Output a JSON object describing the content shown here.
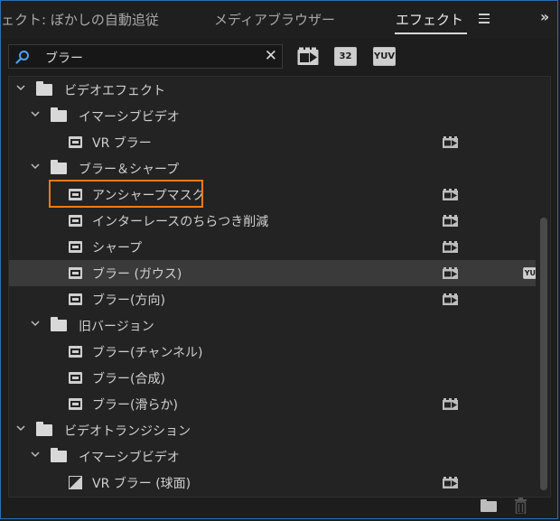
{
  "tabs": [
    {
      "label": "ェクト: ぼかしの自動追従",
      "active": false
    },
    {
      "label": "メディアブラウザー",
      "active": false
    },
    {
      "label": "エフェクト",
      "active": true
    }
  ],
  "search": {
    "value": "ブラー"
  },
  "filter_buttons": {
    "accelerated": "",
    "bit32": "32",
    "yuv": "YUV"
  },
  "tree": [
    {
      "label": "ビデオエフェクト",
      "kind": "folder",
      "level": 0
    },
    {
      "label": "イマーシブビデオ",
      "kind": "folder",
      "level": 1
    },
    {
      "label": "VR ブラー",
      "kind": "effect",
      "level": 2,
      "accel": true
    },
    {
      "label": "ブラー＆シャープ",
      "kind": "folder",
      "level": 1
    },
    {
      "label": "アンシャープマスク",
      "kind": "effect",
      "level": 2,
      "accel": true
    },
    {
      "label": "インターレースのちらつき削減",
      "kind": "effect",
      "level": 2,
      "accel": true
    },
    {
      "label": "シャープ",
      "kind": "effect",
      "level": 2,
      "accel": true
    },
    {
      "label": "ブラー (ガウス)",
      "kind": "effect",
      "level": 2,
      "accel": true,
      "yuv": true,
      "selected": true
    },
    {
      "label": "ブラー(方向)",
      "kind": "effect",
      "level": 2,
      "accel": true
    },
    {
      "label": "旧バージョン",
      "kind": "folder",
      "level": 1
    },
    {
      "label": "ブラー(チャンネル)",
      "kind": "effect",
      "level": 2
    },
    {
      "label": "ブラー(合成)",
      "kind": "effect",
      "level": 2
    },
    {
      "label": "ブラー(滑らか)",
      "kind": "effect",
      "level": 2,
      "accel": true
    },
    {
      "label": "ビデオトランジション",
      "kind": "folder",
      "level": 0
    },
    {
      "label": "イマーシブビデオ",
      "kind": "folder",
      "level": 1
    },
    {
      "label": "VR ブラー (球面)",
      "kind": "transition",
      "level": 2,
      "accel": true
    }
  ],
  "colors": {
    "highlight": "#f07c1a",
    "accent_border": "#2f6fb0",
    "search_icon": "#4a9ff0"
  }
}
